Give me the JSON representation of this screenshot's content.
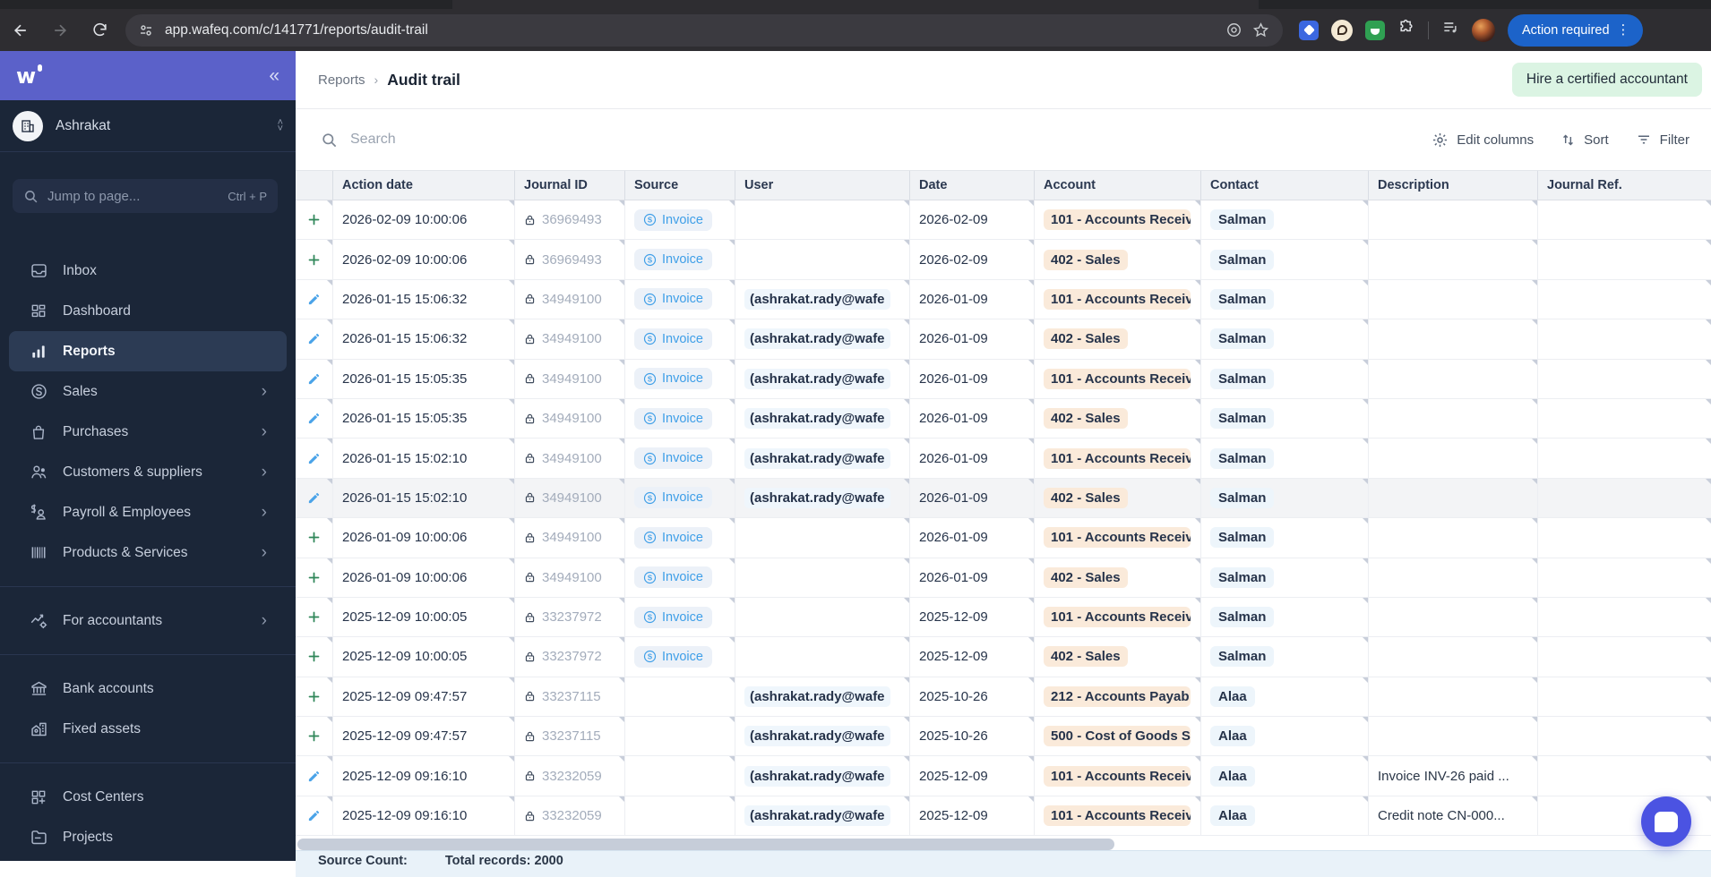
{
  "browser": {
    "url": "app.wafeq.com/c/141771/reports/audit-trail",
    "action_required_label": "Action required"
  },
  "sidebar": {
    "org_name": "Ashrakat",
    "jump_placeholder": "Jump to page...",
    "jump_shortcut": "Ctrl + P",
    "items": [
      {
        "id": "inbox",
        "icon": "inbox-icon",
        "label": "Inbox"
      },
      {
        "id": "dashboard",
        "icon": "dashboard-icon",
        "label": "Dashboard"
      },
      {
        "id": "reports",
        "icon": "reports-icon",
        "label": "Reports",
        "active": true
      },
      {
        "id": "sales",
        "icon": "sales-icon",
        "label": "Sales",
        "chevron": true
      },
      {
        "id": "purchases",
        "icon": "purchases-icon",
        "label": "Purchases",
        "chevron": true
      },
      {
        "id": "customers-suppliers",
        "icon": "customers-icon",
        "label": "Customers & suppliers",
        "chevron": true
      },
      {
        "id": "payroll-employees",
        "icon": "payroll-icon",
        "label": "Payroll & Employees",
        "chevron": true
      },
      {
        "id": "products-services",
        "icon": "products-icon",
        "label": "Products & Services",
        "chevron": true
      },
      {
        "divider": true
      },
      {
        "id": "for-accountants",
        "icon": "accountants-icon",
        "label": "For accountants",
        "chevron": true
      },
      {
        "divider": true
      },
      {
        "id": "bank-accounts",
        "icon": "bank-icon",
        "label": "Bank accounts"
      },
      {
        "id": "fixed-assets",
        "icon": "fixed-assets-icon",
        "label": "Fixed assets"
      },
      {
        "divider": true
      },
      {
        "id": "cost-centers",
        "icon": "cost-centers-icon",
        "label": "Cost Centers"
      },
      {
        "id": "projects",
        "icon": "projects-icon",
        "label": "Projects"
      }
    ]
  },
  "header": {
    "breadcrumb_parent": "Reports",
    "breadcrumb_separator": "›",
    "breadcrumb_current": "Audit trail",
    "hire_button_label": "Hire a certified accountant"
  },
  "toolbar": {
    "search_placeholder": "Search",
    "edit_columns_label": "Edit columns",
    "sort_label": "Sort",
    "filter_label": "Filter"
  },
  "table": {
    "columns": [
      "",
      "Action date",
      "Journal ID",
      "Source",
      "User",
      "Date",
      "Account",
      "Contact",
      "Description",
      "Journal Ref."
    ],
    "rows": [
      {
        "action": "add",
        "action_date": "2026-02-09 10:00:06",
        "journal_id": "36969493",
        "source": "Invoice",
        "user": "",
        "date": "2026-02-09",
        "account": "101 - Accounts Receiv",
        "contact": "Salman",
        "description": "",
        "journal_ref": ""
      },
      {
        "action": "add",
        "action_date": "2026-02-09 10:00:06",
        "journal_id": "36969493",
        "source": "Invoice",
        "user": "",
        "date": "2026-02-09",
        "account": "402 - Sales",
        "contact": "Salman",
        "description": "",
        "journal_ref": ""
      },
      {
        "action": "edit",
        "action_date": "2026-01-15 15:06:32",
        "journal_id": "34949100",
        "source": "Invoice",
        "user": "(ashrakat.rady@wafe",
        "date": "2026-01-09",
        "account": "101 - Accounts Receiv",
        "contact": "Salman",
        "description": "",
        "journal_ref": ""
      },
      {
        "action": "edit",
        "action_date": "2026-01-15 15:06:32",
        "journal_id": "34949100",
        "source": "Invoice",
        "user": "(ashrakat.rady@wafe",
        "date": "2026-01-09",
        "account": "402 - Sales",
        "contact": "Salman",
        "description": "",
        "journal_ref": ""
      },
      {
        "action": "edit",
        "action_date": "2026-01-15 15:05:35",
        "journal_id": "34949100",
        "source": "Invoice",
        "user": "(ashrakat.rady@wafe",
        "date": "2026-01-09",
        "account": "101 - Accounts Receiv",
        "contact": "Salman",
        "description": "",
        "journal_ref": ""
      },
      {
        "action": "edit",
        "action_date": "2026-01-15 15:05:35",
        "journal_id": "34949100",
        "source": "Invoice",
        "user": "(ashrakat.rady@wafe",
        "date": "2026-01-09",
        "account": "402 - Sales",
        "contact": "Salman",
        "description": "",
        "journal_ref": ""
      },
      {
        "action": "edit",
        "action_date": "2026-01-15 15:02:10",
        "journal_id": "34949100",
        "source": "Invoice",
        "user": "(ashrakat.rady@wafe",
        "date": "2026-01-09",
        "account": "101 - Accounts Receiv",
        "contact": "Salman",
        "description": "",
        "journal_ref": ""
      },
      {
        "action": "edit",
        "action_date": "2026-01-15 15:02:10",
        "journal_id": "34949100",
        "source": "Invoice",
        "user": "(ashrakat.rady@wafe",
        "date": "2026-01-09",
        "account": "402 - Sales",
        "contact": "Salman",
        "description": "",
        "journal_ref": "",
        "highlighted": true
      },
      {
        "action": "add",
        "action_date": "2026-01-09 10:00:06",
        "journal_id": "34949100",
        "source": "Invoice",
        "user": "",
        "date": "2026-01-09",
        "account": "101 - Accounts Receiv",
        "contact": "Salman",
        "description": "",
        "journal_ref": ""
      },
      {
        "action": "add",
        "action_date": "2026-01-09 10:00:06",
        "journal_id": "34949100",
        "source": "Invoice",
        "user": "",
        "date": "2026-01-09",
        "account": "402 - Sales",
        "contact": "Salman",
        "description": "",
        "journal_ref": ""
      },
      {
        "action": "add",
        "action_date": "2025-12-09 10:00:05",
        "journal_id": "33237972",
        "source": "Invoice",
        "user": "",
        "date": "2025-12-09",
        "account": "101 - Accounts Receiv",
        "contact": "Salman",
        "description": "",
        "journal_ref": ""
      },
      {
        "action": "add",
        "action_date": "2025-12-09 10:00:05",
        "journal_id": "33237972",
        "source": "Invoice",
        "user": "",
        "date": "2025-12-09",
        "account": "402 - Sales",
        "contact": "Salman",
        "description": "",
        "journal_ref": ""
      },
      {
        "action": "add",
        "action_date": "2025-12-09 09:47:57",
        "journal_id": "33237115",
        "source": "",
        "user": "(ashrakat.rady@wafe",
        "date": "2025-10-26",
        "account": "212 - Accounts Payab",
        "contact": "Alaa",
        "description": "",
        "journal_ref": ""
      },
      {
        "action": "add",
        "action_date": "2025-12-09 09:47:57",
        "journal_id": "33237115",
        "source": "",
        "user": "(ashrakat.rady@wafe",
        "date": "2025-10-26",
        "account": "500 - Cost of Goods S",
        "contact": "Alaa",
        "description": "",
        "journal_ref": ""
      },
      {
        "action": "edit",
        "action_date": "2025-12-09 09:16:10",
        "journal_id": "33232059",
        "source": "",
        "user": "(ashrakat.rady@wafe",
        "date": "2025-12-09",
        "account": "101 - Accounts Receiv",
        "contact": "Alaa",
        "description": "Invoice INV-26 paid ...",
        "journal_ref": ""
      },
      {
        "action": "edit",
        "action_date": "2025-12-09 09:16:10",
        "journal_id": "33232059",
        "source": "",
        "user": "(ashrakat.rady@wafe",
        "date": "2025-12-09",
        "account": "101 - Accounts Receiv",
        "contact": "Alaa",
        "description": "Credit note CN-000...",
        "journal_ref": ""
      }
    ]
  },
  "footer": {
    "source_count_label": "Source Count:",
    "total_records_label": "Total records: 2000"
  },
  "colors": {
    "accent_purple": "#5B61C9",
    "sidebar_bg": "#1B2638",
    "sidebar_active_bg": "#2C3B54",
    "hire_button_bg": "#DBF4E3",
    "source_badge_text": "#3F9FE8",
    "account_badge_bg": "#FAEADA",
    "contact_badge_bg": "#EDF5FB",
    "add_icon_green": "#2F8659",
    "edit_icon_blue": "#4AA3E8",
    "action_required_bg": "#1C63C9",
    "chat_launcher_bg": "#4B53E2"
  }
}
